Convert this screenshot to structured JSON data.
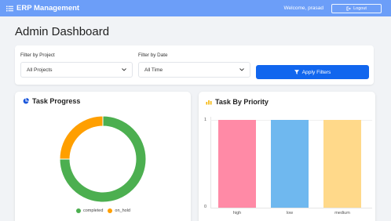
{
  "navbar": {
    "brand": "ERP Management",
    "welcome": "Welcome, prasad",
    "logout": "Logout"
  },
  "page_title": "Admin Dashboard",
  "filters": {
    "project_label": "Filter by Project",
    "project_value": "All Projects",
    "date_label": "Filter by Date",
    "date_value": "All Time",
    "apply_label": "Apply Filters"
  },
  "task_progress": {
    "title": "Task Progress",
    "legend": [
      {
        "label": "completed",
        "color": "#4caf50"
      },
      {
        "label": "on_hold",
        "color": "#ff9f00"
      }
    ],
    "chart_data": {
      "type": "pie",
      "labels": [
        "completed",
        "on_hold"
      ],
      "values": [
        3,
        1
      ],
      "colors": [
        "#4caf50",
        "#ff9f00"
      ]
    }
  },
  "task_priority": {
    "title": "Task By Priority",
    "chart_data": {
      "type": "bar",
      "categories": [
        "high",
        "low",
        "medium"
      ],
      "values": [
        1,
        1,
        1
      ],
      "ylim": [
        0,
        1
      ],
      "yticks": [
        "1",
        "0"
      ],
      "colors": [
        "#ff8aa6",
        "#6fb8ef",
        "#ffd98a"
      ]
    }
  }
}
